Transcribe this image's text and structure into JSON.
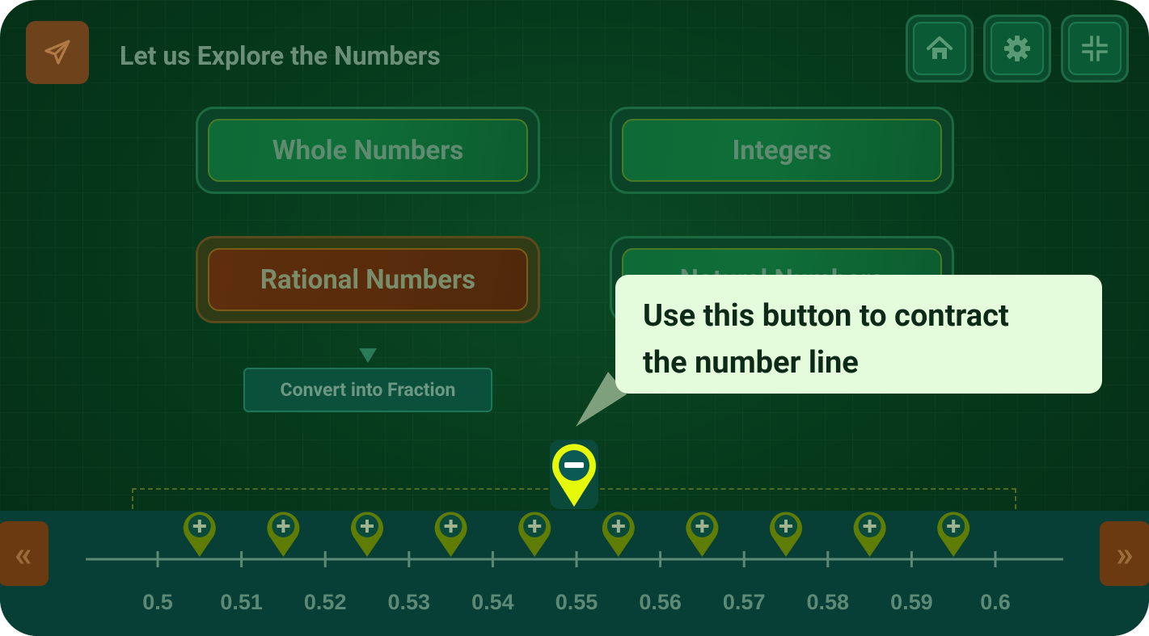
{
  "header": {
    "title": "Let us Explore the Numbers"
  },
  "categories": {
    "whole": "Whole Numbers",
    "integers": "Integers",
    "rational": "Rational Numbers",
    "natural": "Natural Numbers"
  },
  "convert_button": "Convert into Fraction",
  "tooltip": {
    "line1": "Use this button to contract",
    "line2": "the number line"
  },
  "number_line": {
    "ticks": [
      "0.5",
      "0.51",
      "0.52",
      "0.53",
      "0.54",
      "0.55",
      "0.56",
      "0.57",
      "0.58",
      "0.59",
      "0.6"
    ]
  },
  "colors": {
    "accent": "#e6f90a",
    "pin": "#5f7d05",
    "tooltip_bg": "#e4fbdc"
  },
  "icons": {
    "menu": "paper-plane-icon",
    "home": "home-icon",
    "settings": "gear-icon",
    "collapse": "collapse-icon"
  }
}
